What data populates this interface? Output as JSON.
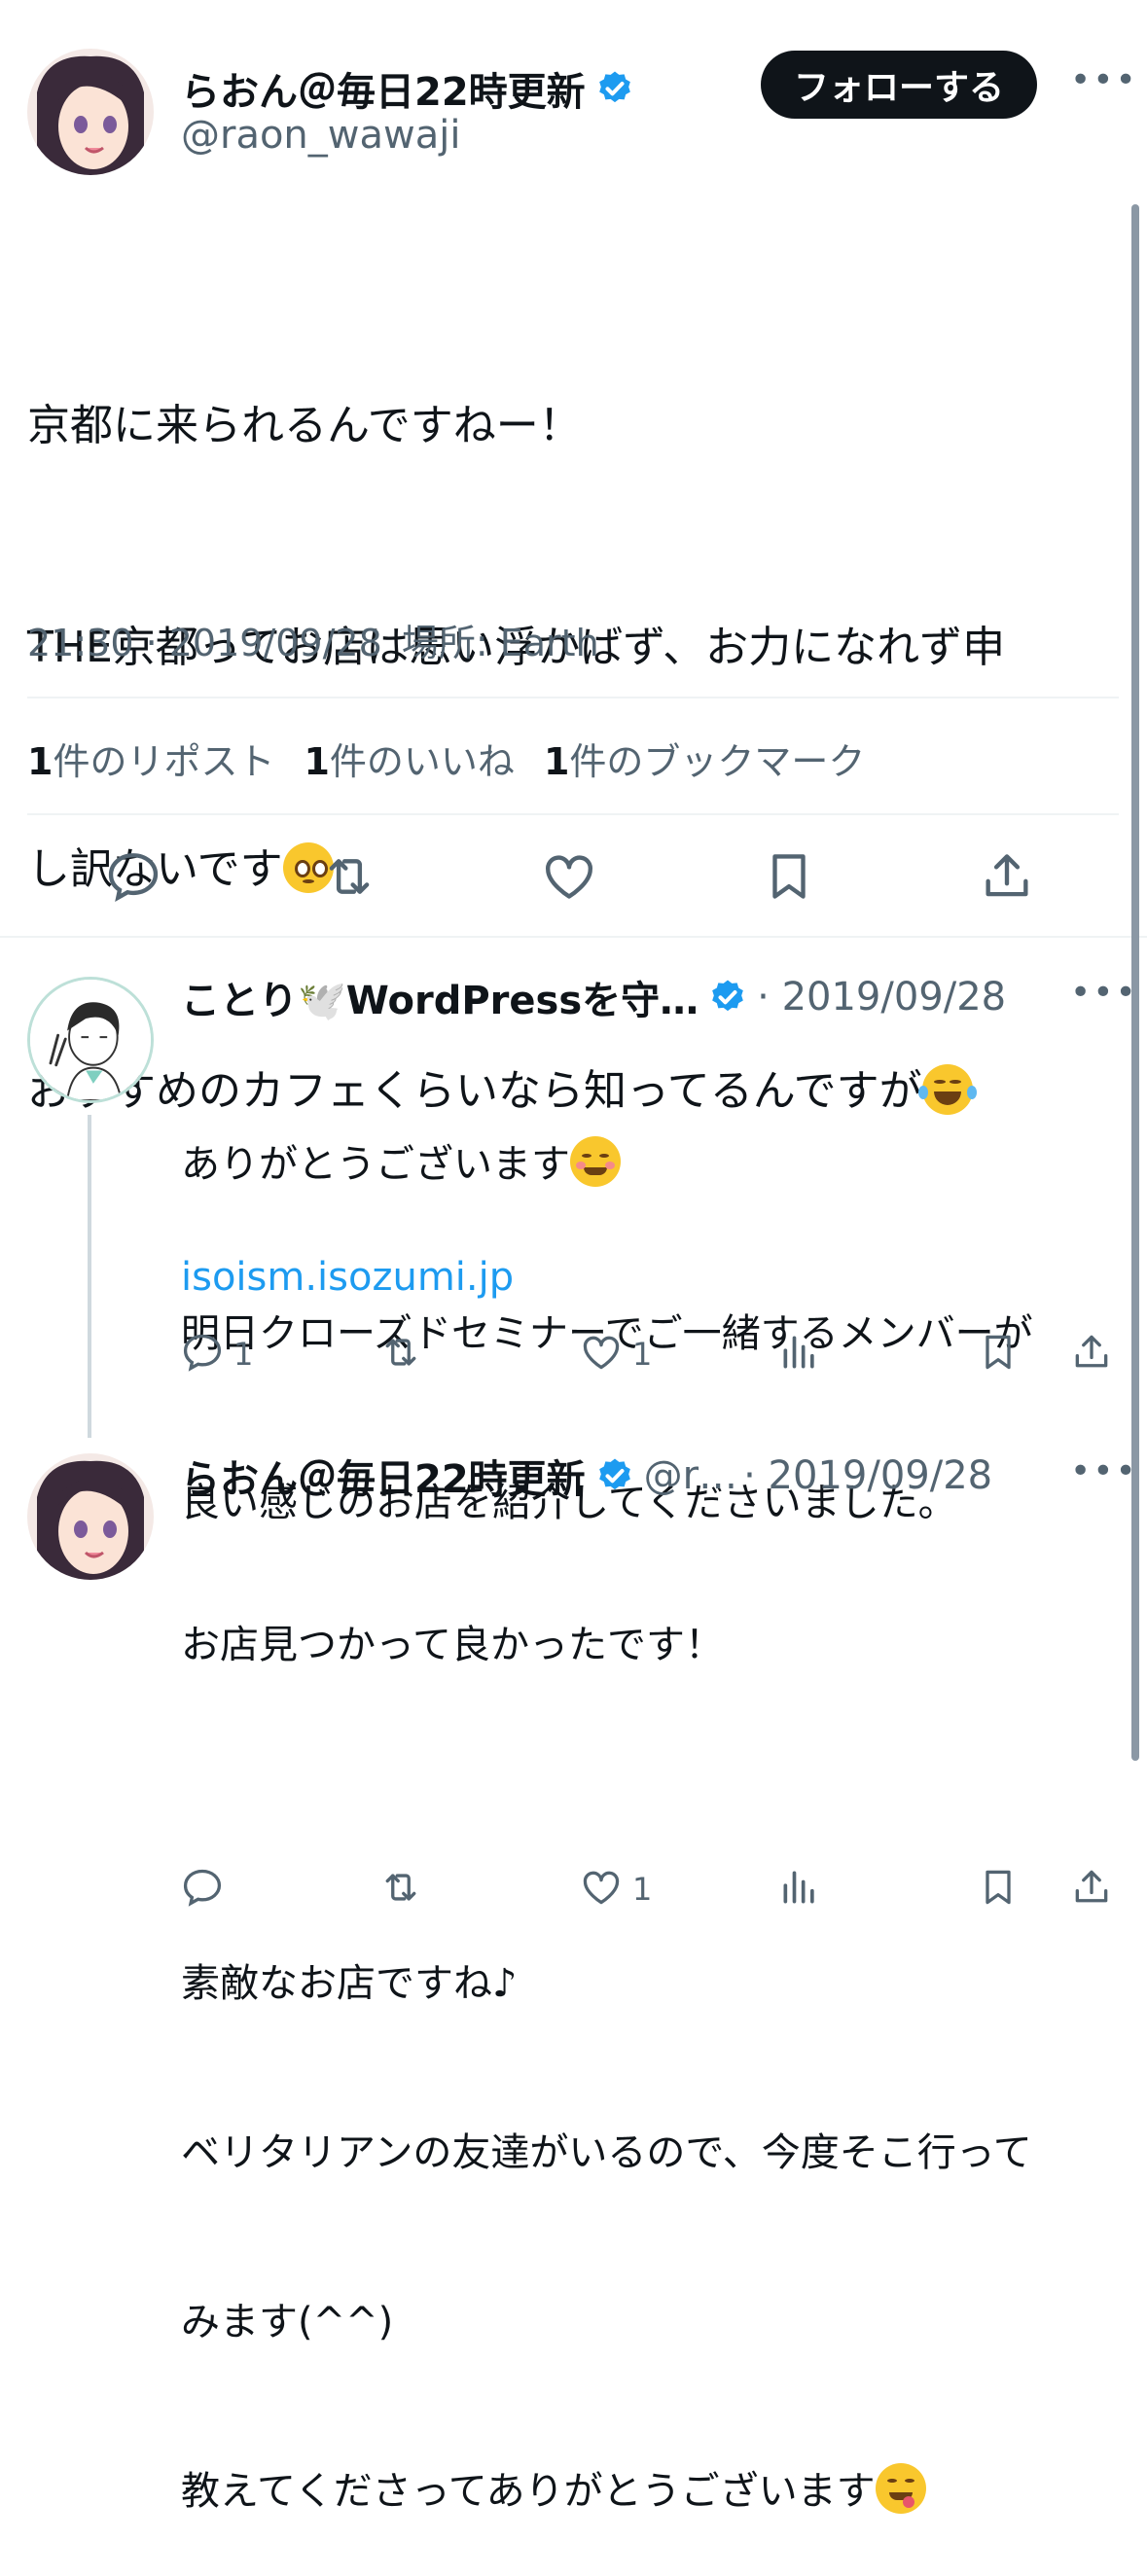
{
  "main_tweet": {
    "author_name": "らおん＠毎日22時更新",
    "author_handle": "@raon_wawaji",
    "follow_label": "フォローする",
    "text_lines": [
      "京都に来られるんですねー！",
      "THE京都ってお店は思い浮かばず、お力になれず申",
      "し訳ないです",
      "おすすめのカフェくらいなら知ってるんですが"
    ],
    "time": "21:30 · 2019/09/28",
    "location_label": "場所: Earth",
    "stats": {
      "reposts_count": "1",
      "reposts_label": "件のリポスト",
      "likes_count": "1",
      "likes_label": "件のいいね",
      "bookmarks_count": "1",
      "bookmarks_label": "件のブックマーク"
    }
  },
  "reply1": {
    "author_name": "ことり🕊️WordPressを守…",
    "date": "· 2019/09/28",
    "text_lines": [
      "ありがとうございます",
      "明日クローズドセミナーでご一緒するメンバーが",
      "良い感じのお店を紹介してくださいました。"
    ],
    "link": "isoism.isozumi.jp",
    "reply_count": "1",
    "like_count": "1"
  },
  "reply2": {
    "author_name": "らおん＠毎日22時更新",
    "author_handle": "@r…",
    "date": "· 2019/09/28",
    "text_lines": [
      "お店見つかって良かったです！",
      "",
      "素敵なお店ですね♪",
      "ベリタリアンの友達がいるので、今度そこ行って",
      "みます(^^)",
      "教えてくださってありがとうございます"
    ],
    "like_count": "1"
  },
  "colors": {
    "text": "#0f1419",
    "muted": "#536471",
    "link": "#1d9bf0",
    "verified": "#1d9bf0",
    "divider": "#eff3f4"
  },
  "icons": [
    "verified-badge-icon",
    "more-icon",
    "reply-icon",
    "repost-icon",
    "like-icon",
    "bookmark-icon",
    "share-icon",
    "views-icon"
  ]
}
